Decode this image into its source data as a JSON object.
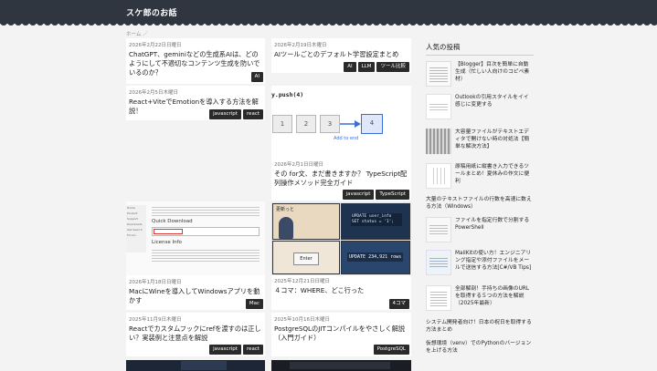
{
  "site": {
    "title": "スケ郎のお話"
  },
  "breadcrumb": "ホーム ／",
  "cards": [
    {
      "date": "2026年2月22日日曜日",
      "title": "ChatGPT、geminiなどの生成系AIは、どのようにして不適切なコンテンツ生成を防いでいるのか？",
      "tags": [
        "AI"
      ]
    },
    {
      "date": "2026年2月19日木曜日",
      "title": "AIツールごとのデフォルト学習設定まとめ",
      "tags": [
        "AI",
        "LLM",
        "ツール比較"
      ]
    },
    {
      "date": "2026年2月5日木曜日",
      "title": "React+ViteでEmotionを導入する方法を解説！",
      "tags": [
        "javascript",
        "react"
      ]
    },
    {
      "date": "2026年2月1日日曜日",
      "title": "その for文、まだ書きますか？ TypeScript配列操作メソッド完全ガイド",
      "tags": [
        "javascript",
        "TypeScript"
      ]
    },
    {
      "date": "2026年1月18日日曜日",
      "title": "MacにWineを導入してWindowsアプリを動かす",
      "tags": [
        "Mac"
      ]
    },
    {
      "date": "2025年12月21日日曜日",
      "title": "４コマ：WHERE、どこ行った",
      "tags": [
        "4コマ"
      ]
    },
    {
      "date": "2025年11月9日木曜日",
      "title": "Reactでカスタムフックにrefを渡すのは正しい？実装例と注意点を解説",
      "tags": [
        "javascript",
        "react"
      ]
    },
    {
      "date": "2025年10月16日木曜日",
      "title": "PostgreSQLのJITコンパイルをやさしく解説（入門ガイド）",
      "tags": [
        "PostgreSQL"
      ]
    }
  ],
  "thumbs": {
    "push": {
      "code": "y.push(4)",
      "boxes": [
        "1",
        "2",
        "3",
        "4"
      ],
      "caption": "Add to end"
    },
    "wine": {
      "heading": "Quick Download",
      "license": "License Info",
      "nav": [
        "Home",
        "Product",
        "Support",
        "Downloads",
        "Ask Search",
        "Forum"
      ]
    },
    "comic": {
      "bubble": "更新っと",
      "screen1": "UPDATE user_info SET status = '1';",
      "enter": "Enter",
      "result": "UPDATE 234,921 rows"
    }
  },
  "sidebar": {
    "heading": "人気の投稿",
    "posts": [
      "【Blogger】目次を簡単に自動生成（忙しい人向けのコピペ素材）",
      "Outlookの引用スタイルをイイ感じに変更する",
      "大容量ファイルがテキストエディタで開けない時の対処法【簡単な解決方法】",
      "原稿用紙に縦書き入力できるツールまとめ！夏休みの作文に便利",
      "大量のテキストファイルの行数を高速に数える方法（Windows）",
      "ファイルを指定行数で分割するPowerShell",
      "MailKitの使い方！エンジニアリング指定や添付ファイルをメールで送信する方法[C#/VB Tips]",
      "全部解剖！手持ちの画像のURLを取得する５つの方法を解説（2025年最新）",
      "システム開発者向け！日本の祝日を取得する方法まとめ",
      "仮想環境（venv）でのPythonのバージョンを上げる方法"
    ]
  },
  "colors": {
    "header": "#2f3640",
    "tag": "#2a2a2a",
    "accent_blue": "#3a6fd8"
  }
}
